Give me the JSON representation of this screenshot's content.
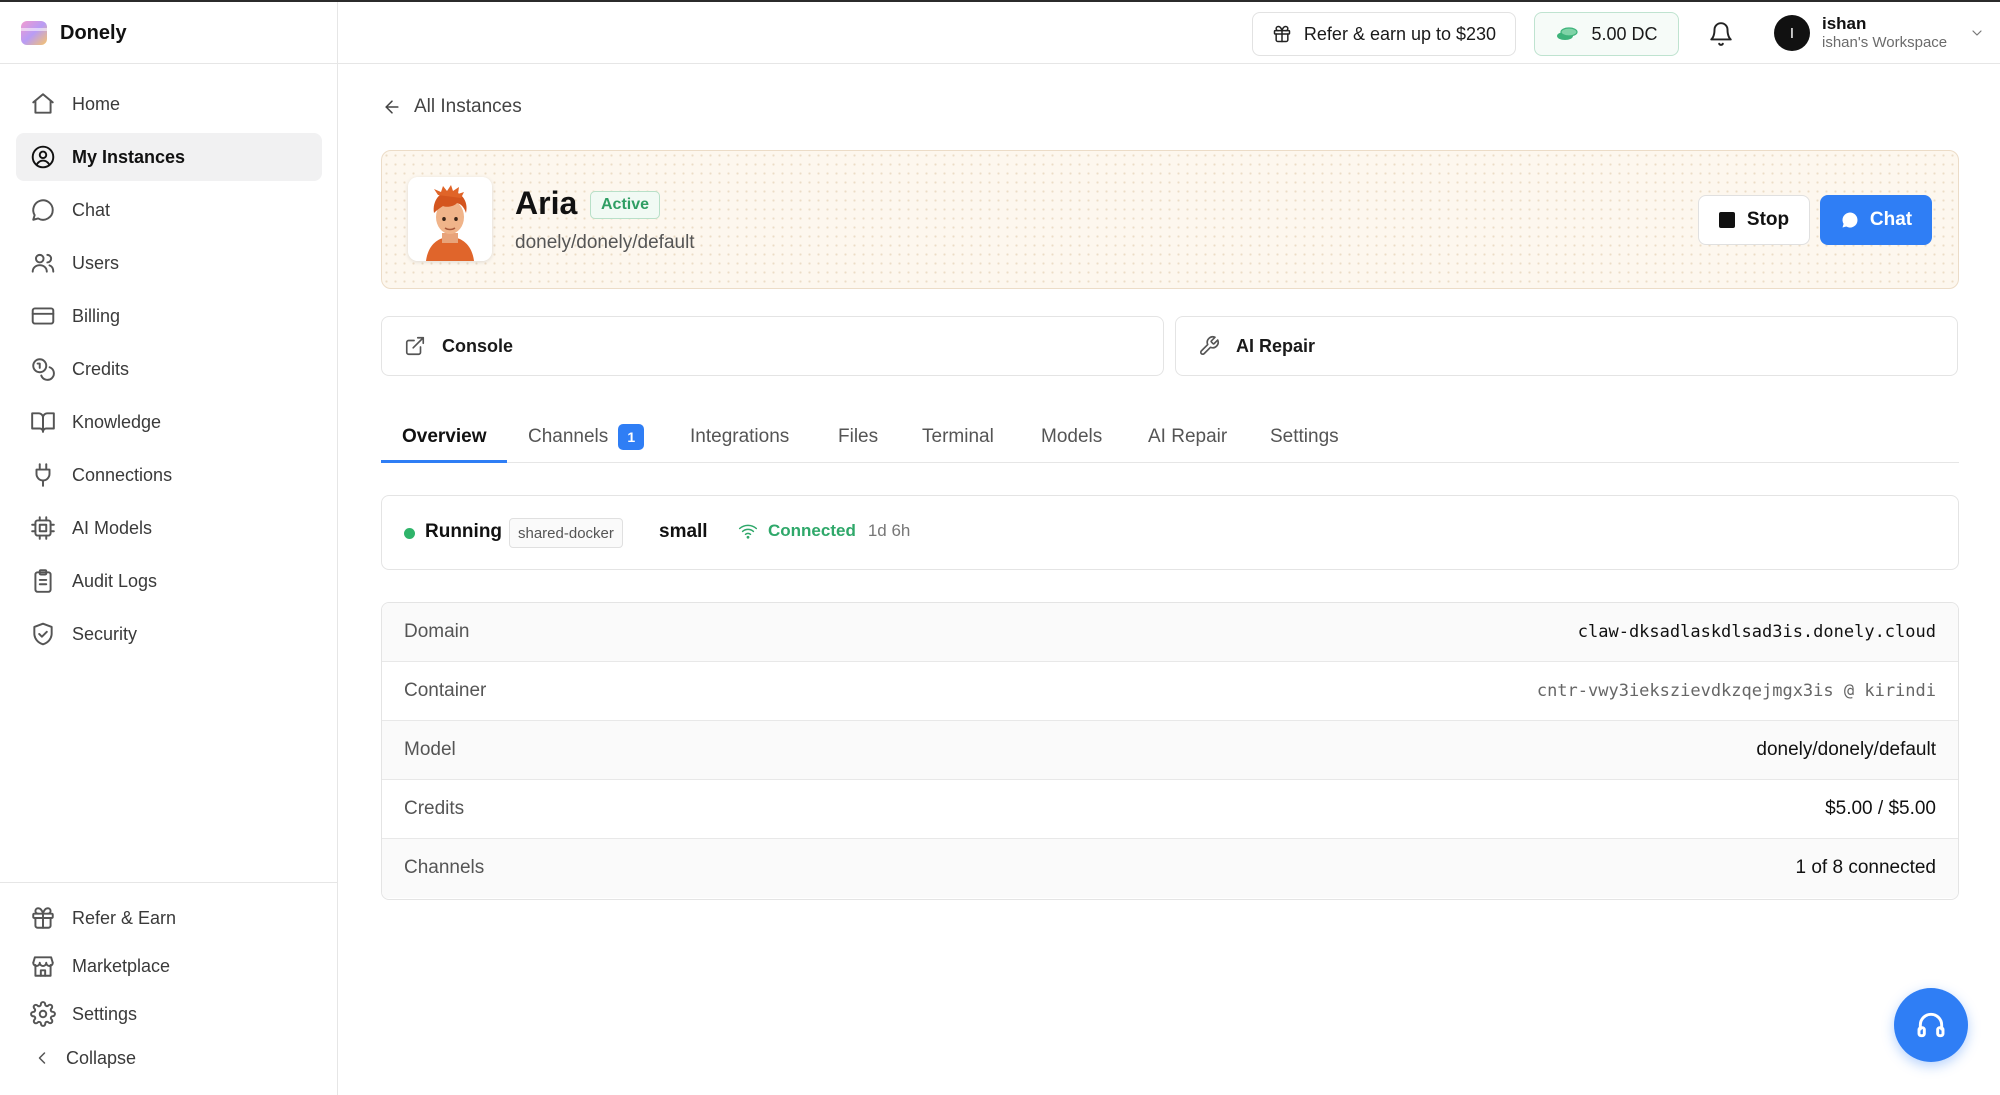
{
  "brand": {
    "name": "Donely"
  },
  "header": {
    "refer_label": "Refer & earn up to $230",
    "credits_label": "5.00 DC",
    "user": {
      "initial": "I",
      "name": "ishan",
      "workspace": "ishan's Workspace"
    }
  },
  "sidebar": {
    "items": [
      {
        "label": "Home",
        "icon": "home-icon"
      },
      {
        "label": "My Instances",
        "icon": "user-circle-icon",
        "active": true
      },
      {
        "label": "Chat",
        "icon": "chat-bubble-icon"
      },
      {
        "label": "Users",
        "icon": "users-icon"
      },
      {
        "label": "Billing",
        "icon": "credit-card-icon"
      },
      {
        "label": "Credits",
        "icon": "coins-icon"
      },
      {
        "label": "Knowledge",
        "icon": "book-icon"
      },
      {
        "label": "Connections",
        "icon": "plug-icon"
      },
      {
        "label": "AI Models",
        "icon": "cpu-icon"
      },
      {
        "label": "Audit Logs",
        "icon": "clipboard-icon"
      },
      {
        "label": "Security",
        "icon": "shield-icon"
      }
    ],
    "footer": [
      {
        "label": "Refer & Earn",
        "icon": "gift-icon"
      },
      {
        "label": "Marketplace",
        "icon": "store-icon"
      },
      {
        "label": "Settings",
        "icon": "gear-icon"
      },
      {
        "label": "Collapse",
        "icon": "chevron-left-icon"
      }
    ]
  },
  "main": {
    "back_label": "All Instances",
    "instance": {
      "name": "Aria",
      "status_badge": "Active",
      "model_path": "donely/donely/default",
      "stop_label": "Stop",
      "chat_label": "Chat"
    },
    "actions": [
      {
        "label": "Console",
        "icon": "external-link-icon"
      },
      {
        "label": "AI Repair",
        "icon": "wrench-icon"
      }
    ],
    "tabs": [
      {
        "label": "Overview",
        "active": true
      },
      {
        "label": "Channels",
        "badge": "1"
      },
      {
        "label": "Integrations"
      },
      {
        "label": "Files"
      },
      {
        "label": "Terminal"
      },
      {
        "label": "Models"
      },
      {
        "label": "AI Repair"
      },
      {
        "label": "Settings"
      }
    ],
    "status": {
      "state": "Running",
      "runtime": "shared-docker",
      "size": "small",
      "connection": "Connected",
      "uptime": "1d 6h"
    },
    "details": [
      {
        "label": "Domain",
        "value": "claw-dksadlaskdlsad3is.donely.cloud"
      },
      {
        "label": "Container",
        "value": "cntr-vwy3iekszievdkzqejmgx3is @ kirindi"
      },
      {
        "label": "Model",
        "value": "donely/donely/default"
      },
      {
        "label": "Credits",
        "value": "$5.00 / $5.00"
      },
      {
        "label": "Channels",
        "value": "1 of 8 connected"
      }
    ]
  },
  "colors": {
    "accent": "#2f7ef5",
    "success": "#2fa86a",
    "hero_bg": "#fdf7ee"
  }
}
